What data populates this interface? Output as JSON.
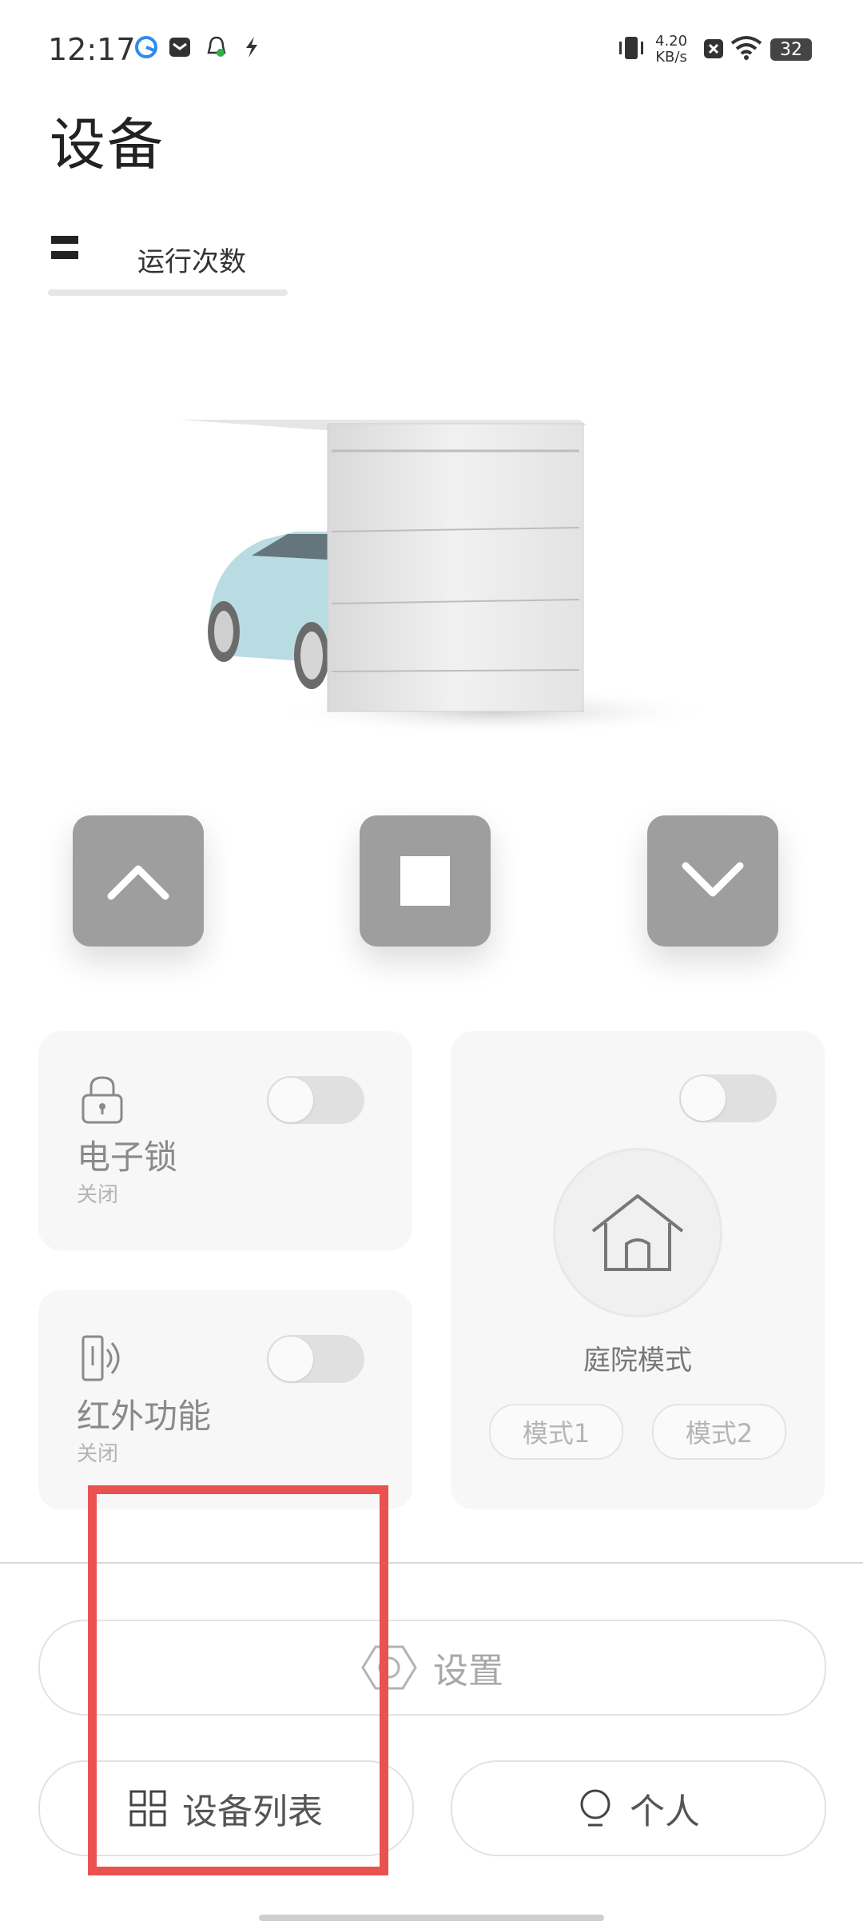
{
  "status_bar": {
    "time": "12:17",
    "net_speed_value": "4.20",
    "net_speed_unit": "KB/s",
    "battery": "32"
  },
  "header": {
    "title": "设备",
    "run_count_value": "--",
    "run_count_label": "运行次数"
  },
  "controls": {
    "up_icon": "chevron-up-icon",
    "stop_icon": "stop-square-icon",
    "down_icon": "chevron-down-icon"
  },
  "cards": {
    "lock": {
      "title": "电子锁",
      "status": "关闭",
      "icon": "lock-icon"
    },
    "infrared": {
      "title": "红外功能",
      "status": "关闭",
      "icon": "infrared-icon"
    },
    "courtyard": {
      "title": "庭院模式",
      "icon": "house-icon",
      "modes": [
        "模式1",
        "模式2"
      ]
    }
  },
  "bottom_nav": {
    "settings_label": "设置",
    "device_list_label": "设备列表",
    "personal_label": "个人"
  },
  "colors": {
    "control_button": "#9e9e9e",
    "card_background": "#f7f7f7",
    "highlight": "#e9524f"
  }
}
